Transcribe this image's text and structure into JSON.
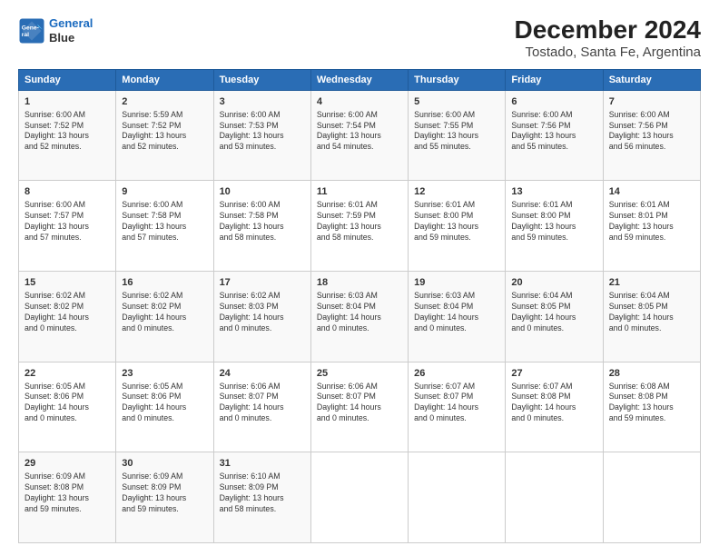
{
  "logo": {
    "line1": "General",
    "line2": "Blue"
  },
  "title": "December 2024",
  "subtitle": "Tostado, Santa Fe, Argentina",
  "weekdays": [
    "Sunday",
    "Monday",
    "Tuesday",
    "Wednesday",
    "Thursday",
    "Friday",
    "Saturday"
  ],
  "weeks": [
    [
      {
        "day": "1",
        "info": "Sunrise: 6:00 AM\nSunset: 7:52 PM\nDaylight: 13 hours\nand 52 minutes."
      },
      {
        "day": "2",
        "info": "Sunrise: 5:59 AM\nSunset: 7:52 PM\nDaylight: 13 hours\nand 52 minutes."
      },
      {
        "day": "3",
        "info": "Sunrise: 6:00 AM\nSunset: 7:53 PM\nDaylight: 13 hours\nand 53 minutes."
      },
      {
        "day": "4",
        "info": "Sunrise: 6:00 AM\nSunset: 7:54 PM\nDaylight: 13 hours\nand 54 minutes."
      },
      {
        "day": "5",
        "info": "Sunrise: 6:00 AM\nSunset: 7:55 PM\nDaylight: 13 hours\nand 55 minutes."
      },
      {
        "day": "6",
        "info": "Sunrise: 6:00 AM\nSunset: 7:56 PM\nDaylight: 13 hours\nand 55 minutes."
      },
      {
        "day": "7",
        "info": "Sunrise: 6:00 AM\nSunset: 7:56 PM\nDaylight: 13 hours\nand 56 minutes."
      }
    ],
    [
      {
        "day": "8",
        "info": "Sunrise: 6:00 AM\nSunset: 7:57 PM\nDaylight: 13 hours\nand 57 minutes."
      },
      {
        "day": "9",
        "info": "Sunrise: 6:00 AM\nSunset: 7:58 PM\nDaylight: 13 hours\nand 57 minutes."
      },
      {
        "day": "10",
        "info": "Sunrise: 6:00 AM\nSunset: 7:58 PM\nDaylight: 13 hours\nand 58 minutes."
      },
      {
        "day": "11",
        "info": "Sunrise: 6:01 AM\nSunset: 7:59 PM\nDaylight: 13 hours\nand 58 minutes."
      },
      {
        "day": "12",
        "info": "Sunrise: 6:01 AM\nSunset: 8:00 PM\nDaylight: 13 hours\nand 59 minutes."
      },
      {
        "day": "13",
        "info": "Sunrise: 6:01 AM\nSunset: 8:00 PM\nDaylight: 13 hours\nand 59 minutes."
      },
      {
        "day": "14",
        "info": "Sunrise: 6:01 AM\nSunset: 8:01 PM\nDaylight: 13 hours\nand 59 minutes."
      }
    ],
    [
      {
        "day": "15",
        "info": "Sunrise: 6:02 AM\nSunset: 8:02 PM\nDaylight: 14 hours\nand 0 minutes."
      },
      {
        "day": "16",
        "info": "Sunrise: 6:02 AM\nSunset: 8:02 PM\nDaylight: 14 hours\nand 0 minutes."
      },
      {
        "day": "17",
        "info": "Sunrise: 6:02 AM\nSunset: 8:03 PM\nDaylight: 14 hours\nand 0 minutes."
      },
      {
        "day": "18",
        "info": "Sunrise: 6:03 AM\nSunset: 8:04 PM\nDaylight: 14 hours\nand 0 minutes."
      },
      {
        "day": "19",
        "info": "Sunrise: 6:03 AM\nSunset: 8:04 PM\nDaylight: 14 hours\nand 0 minutes."
      },
      {
        "day": "20",
        "info": "Sunrise: 6:04 AM\nSunset: 8:05 PM\nDaylight: 14 hours\nand 0 minutes."
      },
      {
        "day": "21",
        "info": "Sunrise: 6:04 AM\nSunset: 8:05 PM\nDaylight: 14 hours\nand 0 minutes."
      }
    ],
    [
      {
        "day": "22",
        "info": "Sunrise: 6:05 AM\nSunset: 8:06 PM\nDaylight: 14 hours\nand 0 minutes."
      },
      {
        "day": "23",
        "info": "Sunrise: 6:05 AM\nSunset: 8:06 PM\nDaylight: 14 hours\nand 0 minutes."
      },
      {
        "day": "24",
        "info": "Sunrise: 6:06 AM\nSunset: 8:07 PM\nDaylight: 14 hours\nand 0 minutes."
      },
      {
        "day": "25",
        "info": "Sunrise: 6:06 AM\nSunset: 8:07 PM\nDaylight: 14 hours\nand 0 minutes."
      },
      {
        "day": "26",
        "info": "Sunrise: 6:07 AM\nSunset: 8:07 PM\nDaylight: 14 hours\nand 0 minutes."
      },
      {
        "day": "27",
        "info": "Sunrise: 6:07 AM\nSunset: 8:08 PM\nDaylight: 14 hours\nand 0 minutes."
      },
      {
        "day": "28",
        "info": "Sunrise: 6:08 AM\nSunset: 8:08 PM\nDaylight: 13 hours\nand 59 minutes."
      }
    ],
    [
      {
        "day": "29",
        "info": "Sunrise: 6:09 AM\nSunset: 8:08 PM\nDaylight: 13 hours\nand 59 minutes."
      },
      {
        "day": "30",
        "info": "Sunrise: 6:09 AM\nSunset: 8:09 PM\nDaylight: 13 hours\nand 59 minutes."
      },
      {
        "day": "31",
        "info": "Sunrise: 6:10 AM\nSunset: 8:09 PM\nDaylight: 13 hours\nand 58 minutes."
      },
      null,
      null,
      null,
      null
    ]
  ]
}
